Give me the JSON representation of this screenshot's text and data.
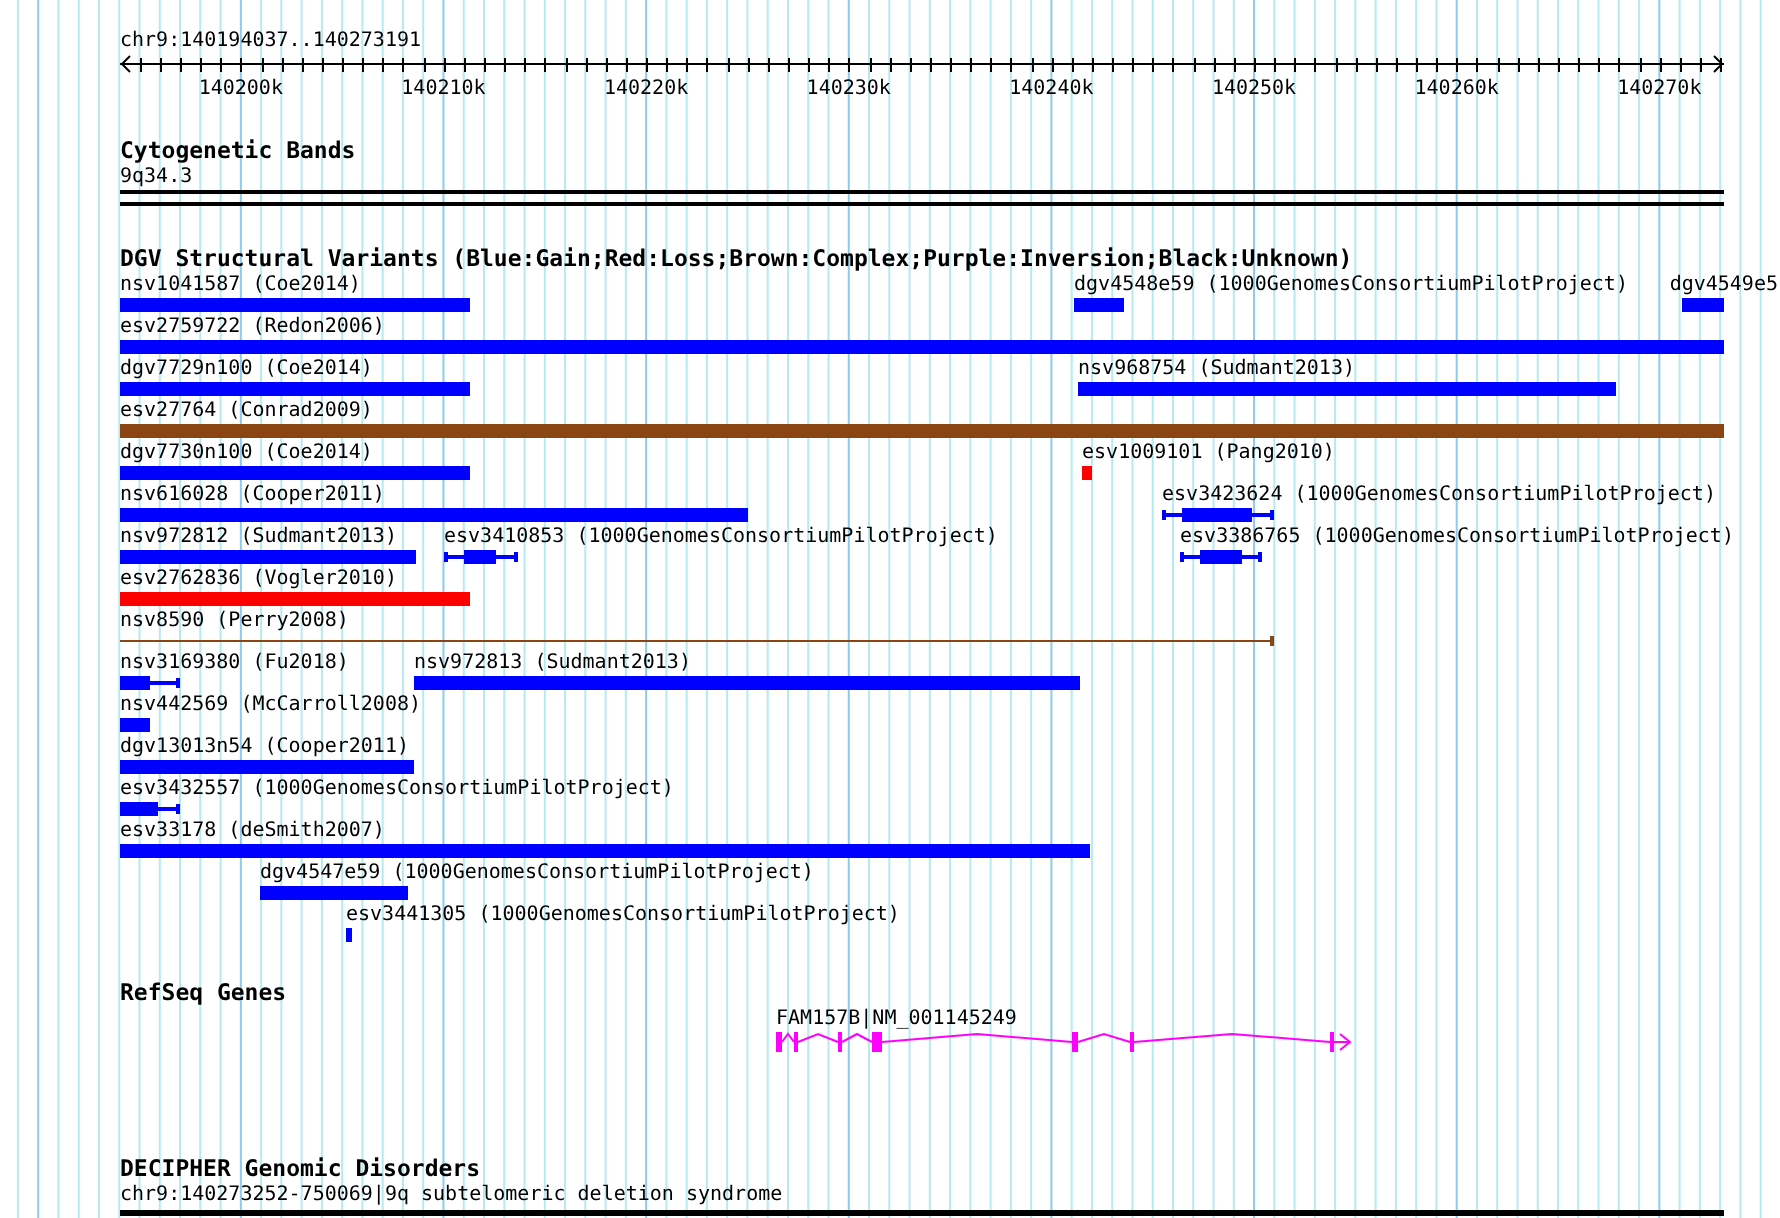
{
  "view": {
    "location": "chr9:140194037..140273191"
  },
  "ruler": {
    "ticks": [
      {
        "label": "140200k"
      },
      {
        "label": "140210k"
      },
      {
        "label": "140220k"
      },
      {
        "label": "140230k"
      },
      {
        "label": "140240k"
      },
      {
        "label": "140250k"
      },
      {
        "label": "140260k"
      },
      {
        "label": "140270k"
      }
    ]
  },
  "tracks": [
    {
      "kind": "bands",
      "title": "Cytogenetic Bands",
      "items": [
        {
          "label": "9q34.3"
        }
      ]
    },
    {
      "kind": "variants",
      "title": "DGV Structural Variants (Blue:Gain;Red:Loss;Brown:Complex;Purple:Inversion;Black:Unknown)",
      "lanes": [
        [
          {
            "kind": "bar",
            "label": "nsv1041587 (Coe2014)",
            "color": "#0000ff"
          },
          {
            "kind": "bar",
            "label": "dgv4548e59 (1000GenomesConsortiumPilotProject)",
            "color": "#0000ff"
          },
          {
            "kind": "bar",
            "label": "dgv4549e5",
            "color": "#0000ff"
          }
        ],
        [
          {
            "kind": "bar",
            "label": "esv2759722 (Redon2006)",
            "color": "#0000ff"
          }
        ],
        [
          {
            "kind": "bar",
            "label": "dgv7729n100 (Coe2014)",
            "color": "#0000ff"
          },
          {
            "kind": "bar",
            "label": "nsv968754 (Sudmant2013)",
            "color": "#0000ff"
          }
        ],
        [
          {
            "kind": "bar",
            "label": "esv27764 (Conrad2009)",
            "color": "#8b4513"
          }
        ],
        [
          {
            "kind": "bar",
            "label": "dgv7730n100 (Coe2014)",
            "color": "#0000ff"
          },
          {
            "kind": "bar",
            "label": "esv1009101 (Pang2010)",
            "color": "#ff0000"
          }
        ],
        [
          {
            "kind": "bar",
            "label": "nsv616028 (Cooper2011)",
            "color": "#0000ff"
          },
          {
            "kind": "whisker",
            "label": "esv3423624 (1000GenomesConsortiumPilotProject)",
            "color": "#0000ff"
          }
        ],
        [
          {
            "kind": "bar",
            "label": "nsv972812 (Sudmant2013)",
            "color": "#0000ff"
          },
          {
            "kind": "whisker",
            "label": "esv3410853 (1000GenomesConsortiumPilotProject)",
            "color": "#0000ff"
          },
          {
            "kind": "whisker",
            "label": "esv3386765 (1000GenomesConsortiumPilotProject)",
            "color": "#0000ff"
          }
        ],
        [
          {
            "kind": "bar",
            "label": "esv2762836 (Vogler2010)",
            "color": "#ff0000"
          }
        ],
        [
          {
            "kind": "line",
            "label": "nsv8590 (Perry2008)",
            "color": "#8b4513"
          }
        ],
        [
          {
            "kind": "whisker",
            "label": "nsv3169380 (Fu2018)",
            "color": "#0000ff"
          },
          {
            "kind": "bar",
            "label": "nsv972813 (Sudmant2013)",
            "color": "#0000ff"
          }
        ],
        [
          {
            "kind": "bar",
            "label": "nsv442569 (McCarroll2008)",
            "color": "#0000ff"
          }
        ],
        [
          {
            "kind": "bar",
            "label": "dgv13013n54 (Cooper2011)",
            "color": "#0000ff"
          }
        ],
        [
          {
            "kind": "whisker",
            "label": "esv3432557 (1000GenomesConsortiumPilotProject)",
            "color": "#0000ff"
          }
        ],
        [
          {
            "kind": "bar",
            "label": "esv33178 (deSmith2007)",
            "color": "#0000ff"
          }
        ],
        [
          {
            "kind": "bar",
            "label": "dgv4547e59 (1000GenomesConsortiumPilotProject)",
            "color": "#0000ff"
          }
        ],
        [
          {
            "kind": "bar",
            "label": "esv3441305 (1000GenomesConsortiumPilotProject)",
            "color": "#0000ff"
          }
        ]
      ]
    },
    {
      "kind": "genes",
      "title": "RefSeq Genes",
      "items": [
        {
          "label": "FAM157B|NM_001145249",
          "forward_strand": true
        }
      ]
    },
    {
      "kind": "regions",
      "title": "DECIPHER Genomic Disorders",
      "items": [
        {
          "label": "chr9:140273252-750069|9q subtelomeric deletion syndrome"
        }
      ]
    }
  ]
}
